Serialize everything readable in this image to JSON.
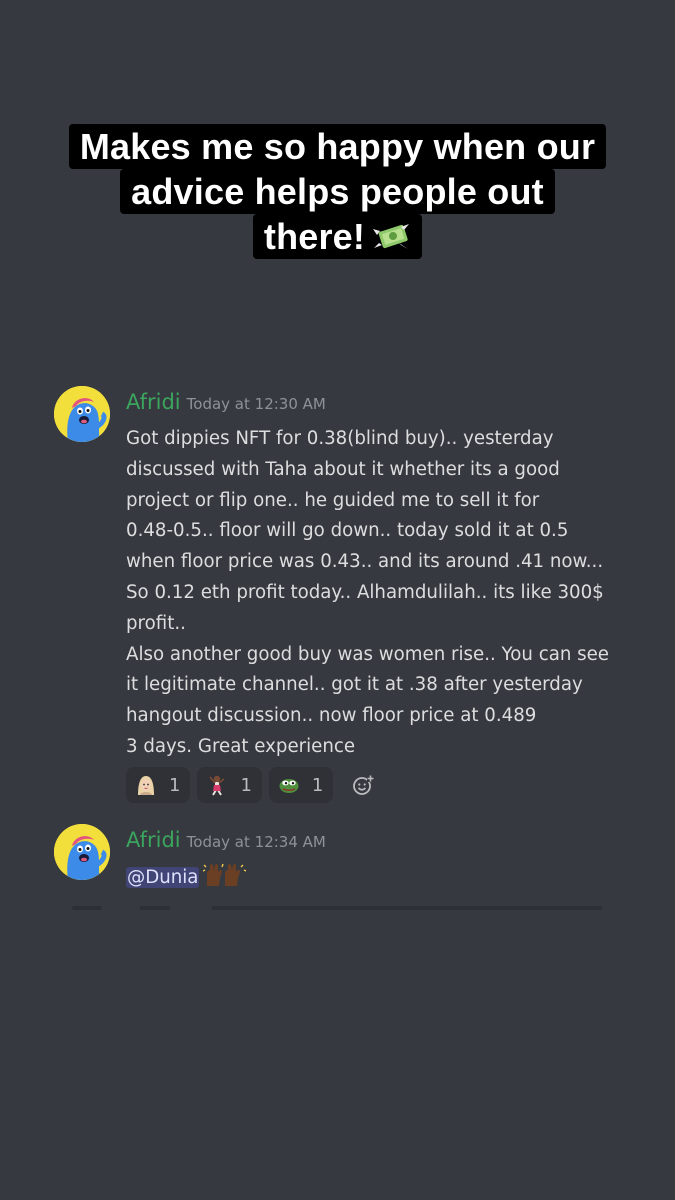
{
  "caption": {
    "lines": [
      "Makes me so happy when our",
      "advice helps people out",
      "there!"
    ],
    "emoji": "money-with-wings-emoji"
  },
  "messages": [
    {
      "username": "Afridi",
      "timestamp": "Today at 12:30 AM",
      "username_color": "#3ba55d",
      "lines": [
        "Got dippies NFT for 0.38(blind buy).. yesterday",
        "discussed with Taha about it whether its a good",
        "project or flip one.. he guided me to sell it for",
        "0.48-0.5.. floor will go down.. today sold it at 0.5",
        "when floor price was 0.43.. and its around .41 now...",
        "So 0.12 eth profit today.. Alhamdulilah.. its like 300$",
        "profit..",
        "Also another good buy was women rise.. You can see",
        "it legitimate channel.. got it at .38 after yesterday",
        "hangout discussion.. now floor price at 0.489",
        "3 days. Great experience"
      ],
      "reactions": [
        {
          "emoji": "woman-avatar-emoji",
          "count": "1"
        },
        {
          "emoji": "dancing-person-emoji",
          "count": "1"
        },
        {
          "emoji": "pepe-frog-emoji",
          "count": "1"
        }
      ]
    },
    {
      "username": "Afridi",
      "timestamp": "Today at 12:34 AM",
      "mention": "@Dunia",
      "emoji": "raising-hands-emoji"
    }
  ],
  "colors": {
    "background": "#36393f",
    "text": "#dcddde",
    "timestamp": "#8e9297",
    "mention_bg": "rgba(88,101,242,0.3)"
  }
}
